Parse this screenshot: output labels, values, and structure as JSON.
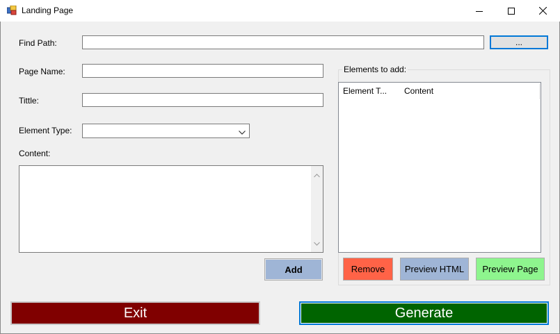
{
  "window": {
    "title": "Landing Page",
    "controls": {
      "minimize": "minimize-icon",
      "maximize": "maximize-icon",
      "close": "close-icon"
    }
  },
  "form": {
    "find_path": {
      "label": "Find Path:",
      "value": "",
      "browse_label": "..."
    },
    "page_name": {
      "label": "Page Name:",
      "value": ""
    },
    "title": {
      "label": "Tittle:",
      "value": ""
    },
    "element_type": {
      "label": "Element Type:",
      "selected": ""
    },
    "content": {
      "label": "Content:",
      "value": ""
    },
    "add_label": "Add"
  },
  "elements_group": {
    "title": "Elements to add:",
    "columns": [
      "Element T...",
      "Content"
    ],
    "rows": [],
    "remove_label": "Remove",
    "preview_html_label": "Preview HTML",
    "preview_page_label": "Preview Page"
  },
  "footer": {
    "exit_label": "Exit",
    "generate_label": "Generate"
  },
  "colors": {
    "add_button": "#9fb5d6",
    "remove_button": "#ff6347",
    "preview_html_button": "#9fb5d6",
    "preview_page_button": "#8ef58e",
    "exit_button": "#800000",
    "generate_button": "#006400",
    "generate_border": "#0078d7"
  }
}
